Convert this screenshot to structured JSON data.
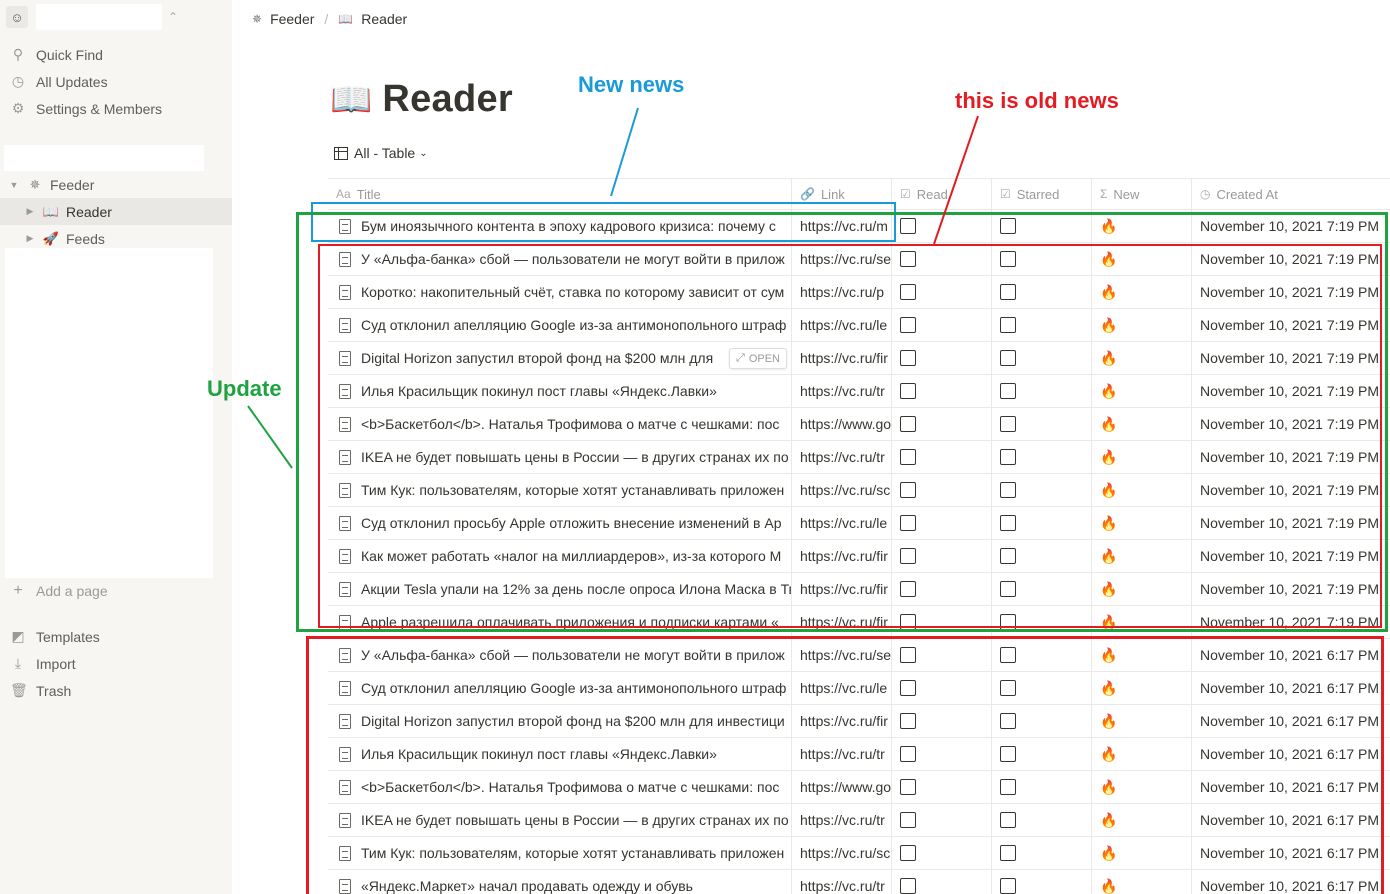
{
  "sidebar": {
    "workspace_avatar": "☺",
    "menu": [
      {
        "label": "Quick Find",
        "icon": "search-icon"
      },
      {
        "label": "All Updates",
        "icon": "clock-icon"
      },
      {
        "label": "Settings & Members",
        "icon": "gear-icon"
      }
    ],
    "tree": [
      {
        "label": "Feeder",
        "emoji": "✵",
        "level": 0
      },
      {
        "label": "Reader",
        "emoji": "📖",
        "level": 1
      },
      {
        "label": "Feeds",
        "emoji": "🚀",
        "level": 1
      }
    ],
    "add_page": "Add a page",
    "bottom": [
      {
        "label": "Templates",
        "icon": "templates-icon"
      },
      {
        "label": "Import",
        "icon": "import-icon"
      },
      {
        "label": "Trash",
        "icon": "trash-icon"
      }
    ]
  },
  "breadcrumb": {
    "items": [
      {
        "label": "Feeder",
        "emoji": "✵"
      },
      {
        "label": "Reader",
        "emoji": "📖"
      }
    ],
    "separator": "/"
  },
  "page": {
    "emoji": "📖",
    "title": "Reader",
    "view_label": "All - Table"
  },
  "table": {
    "columns": [
      {
        "label": "Title",
        "icon": "Aa"
      },
      {
        "label": "Link",
        "icon": "🔗"
      },
      {
        "label": "Read",
        "icon": "☑"
      },
      {
        "label": "Starred",
        "icon": "☑"
      },
      {
        "label": "New",
        "icon": "Σ"
      },
      {
        "label": "Created At",
        "icon": "◷"
      }
    ],
    "open_label": "OPEN",
    "rows": [
      {
        "title": "Бум иноязычного контента в эпоху кадрового кризиса: почему с",
        "link": "https://vc.ru/m",
        "new": "🔥",
        "created": "November 10, 2021 7:19 PM"
      },
      {
        "title": "У «Альфа-банка» сбой — пользователи не могут войти в прилож",
        "link": "https://vc.ru/se",
        "new": "🔥",
        "created": "November 10, 2021 7:19 PM"
      },
      {
        "title": "Коротко: накопительный счёт, ставка по которому зависит от сум",
        "link": "https://vc.ru/p",
        "new": "🔥",
        "created": "November 10, 2021 7:19 PM"
      },
      {
        "title": "Суд отклонил апелляцию Google из-за антимонопольного штраф",
        "link": "https://vc.ru/le",
        "new": "🔥",
        "created": "November 10, 2021 7:19 PM"
      },
      {
        "title": "Digital Horizon запустил второй фонд на $200 млн для",
        "link": "https://vc.ru/fir",
        "new": "🔥",
        "created": "November 10, 2021 7:19 PM"
      },
      {
        "title": "Илья Красильщик покинул пост главы «Яндекс.Лавки»",
        "link": "https://vc.ru/tr",
        "new": "🔥",
        "created": "November 10, 2021 7:19 PM"
      },
      {
        "title": "<b>Баскетбол</b>. Наталья Трофимова о матче с чешками: пос",
        "link": "https://www.go",
        "new": "🔥",
        "created": "November 10, 2021 7:19 PM"
      },
      {
        "title": "IKEA не будет повышать цены в России — в других странах их по",
        "link": "https://vc.ru/tr",
        "new": "🔥",
        "created": "November 10, 2021 7:19 PM"
      },
      {
        "title": "Тим Кук: пользователям, которые хотят устанавливать приложен",
        "link": "https://vc.ru/sc",
        "new": "🔥",
        "created": "November 10, 2021 7:19 PM"
      },
      {
        "title": "Суд отклонил просьбу Apple отложить внесение изменений в Ap",
        "link": "https://vc.ru/le",
        "new": "🔥",
        "created": "November 10, 2021 7:19 PM"
      },
      {
        "title": "Как может работать «налог на миллиардеров», из-за которого М",
        "link": "https://vc.ru/fir",
        "new": "🔥",
        "created": "November 10, 2021 7:19 PM"
      },
      {
        "title": "Акции Tesla упали на 12% за день после опроса Илона Маска в Тв",
        "link": "https://vc.ru/fir",
        "new": "🔥",
        "created": "November 10, 2021 7:19 PM"
      },
      {
        "title": "Apple разрешила оплачивать приложения и подписки картами «",
        "link": "https://vc.ru/fir",
        "new": "🔥",
        "created": "November 10, 2021 7:19 PM"
      },
      {
        "title": "У «Альфа-банка» сбой — пользователи не могут войти в прилож",
        "link": "https://vc.ru/se",
        "new": "🔥",
        "created": "November 10, 2021 6:17 PM"
      },
      {
        "title": "Суд отклонил апелляцию Google из-за антимонопольного штраф",
        "link": "https://vc.ru/le",
        "new": "🔥",
        "created": "November 10, 2021 6:17 PM"
      },
      {
        "title": "Digital Horizon запустил второй фонд на $200 млн для инвестици",
        "link": "https://vc.ru/fir",
        "new": "🔥",
        "created": "November 10, 2021 6:17 PM"
      },
      {
        "title": "Илья Красильщик покинул пост главы «Яндекс.Лавки»",
        "link": "https://vc.ru/tr",
        "new": "🔥",
        "created": "November 10, 2021 6:17 PM"
      },
      {
        "title": "<b>Баскетбол</b>. Наталья Трофимова о матче с чешками: пос",
        "link": "https://www.go",
        "new": "🔥",
        "created": "November 10, 2021 6:17 PM"
      },
      {
        "title": "IKEA не будет повышать цены в России — в других странах их по",
        "link": "https://vc.ru/tr",
        "new": "🔥",
        "created": "November 10, 2021 6:17 PM"
      },
      {
        "title": "Тим Кук: пользователям, которые хотят устанавливать приложен",
        "link": "https://vc.ru/sc",
        "new": "🔥",
        "created": "November 10, 2021 6:17 PM"
      },
      {
        "title": "«Яндекс.Маркет» начал продавать одежду и обувь",
        "link": "https://vc.ru/tr",
        "new": "🔥",
        "created": "November 10, 2021 6:17 PM"
      }
    ]
  },
  "annotations": {
    "new_news": {
      "text": "New news",
      "color": "#1a9ad6"
    },
    "old_news": {
      "text": "this is old news",
      "color": "#e31b23"
    },
    "update": {
      "text": "Update",
      "color": "#1fa340"
    }
  }
}
